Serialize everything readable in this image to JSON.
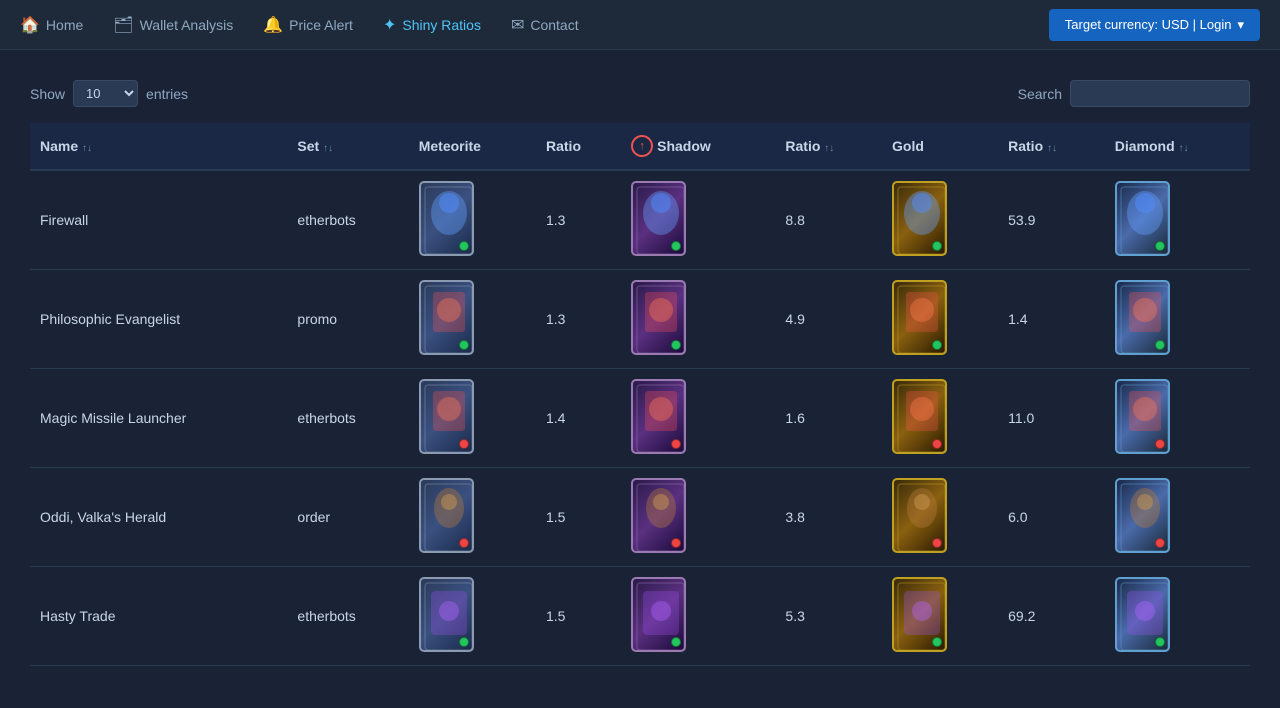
{
  "nav": {
    "items": [
      {
        "label": "Home",
        "icon": "🏠",
        "active": false,
        "id": "home"
      },
      {
        "label": "Wallet Analysis",
        "icon": "💼",
        "active": false,
        "id": "wallet-analysis"
      },
      {
        "label": "Price Alert",
        "icon": "🔔",
        "active": false,
        "id": "price-alert"
      },
      {
        "label": "Shiny Ratios",
        "icon": "✦",
        "active": true,
        "id": "shiny-ratios"
      },
      {
        "label": "Contact",
        "icon": "✉",
        "active": false,
        "id": "contact"
      }
    ],
    "target_currency_button": "Target currency: USD | Login"
  },
  "table_controls": {
    "show_label": "Show",
    "entries_label": "entries",
    "search_label": "Search",
    "search_placeholder": "",
    "show_value": "10"
  },
  "table": {
    "columns": [
      {
        "label": "Name",
        "sort": "default",
        "id": "name"
      },
      {
        "label": "Set",
        "sort": "default",
        "id": "set"
      },
      {
        "label": "Meteorite",
        "sort": "default",
        "id": "meteorite"
      },
      {
        "label": "Ratio",
        "sort": "default",
        "id": "ratio-meteorite"
      },
      {
        "label": "Shadow",
        "sort": "active-asc",
        "id": "shadow"
      },
      {
        "label": "Ratio",
        "sort": "default",
        "id": "ratio-shadow"
      },
      {
        "label": "Gold",
        "sort": "default",
        "id": "gold"
      },
      {
        "label": "Ratio",
        "sort": "default",
        "id": "ratio-gold"
      },
      {
        "label": "Diamond",
        "sort": "default",
        "id": "diamond"
      }
    ],
    "rows": [
      {
        "name": "Firewall",
        "set": "etherbots",
        "meteorite_ratio": "1.3",
        "shadow_ratio": "8.8",
        "gold_ratio": "53.9",
        "card_type": "blue",
        "badge_met": "green",
        "badge_shad": "green",
        "badge_gold": "green",
        "badge_dia": "green"
      },
      {
        "name": "Philosophic Evangelist",
        "set": "promo",
        "meteorite_ratio": "1.3",
        "shadow_ratio": "4.9",
        "gold_ratio": "1.4",
        "card_type": "red",
        "badge_met": "green",
        "badge_shad": "green",
        "badge_gold": "green",
        "badge_dia": "green"
      },
      {
        "name": "Magic Missile Launcher",
        "set": "etherbots",
        "meteorite_ratio": "1.4",
        "shadow_ratio": "1.6",
        "gold_ratio": "11.0",
        "card_type": "red",
        "badge_met": "red",
        "badge_shad": "red",
        "badge_gold": "red",
        "badge_dia": "red"
      },
      {
        "name": "Oddi, Valka's Herald",
        "set": "order",
        "meteorite_ratio": "1.5",
        "shadow_ratio": "3.8",
        "gold_ratio": "6.0",
        "card_type": "brown",
        "badge_met": "red",
        "badge_shad": "red",
        "badge_gold": "red",
        "badge_dia": "red"
      },
      {
        "name": "Hasty Trade",
        "set": "etherbots",
        "meteorite_ratio": "1.5",
        "shadow_ratio": "5.3",
        "gold_ratio": "69.2",
        "card_type": "purple",
        "badge_met": "green",
        "badge_shad": "green",
        "badge_gold": "green",
        "badge_dia": "green"
      }
    ]
  }
}
